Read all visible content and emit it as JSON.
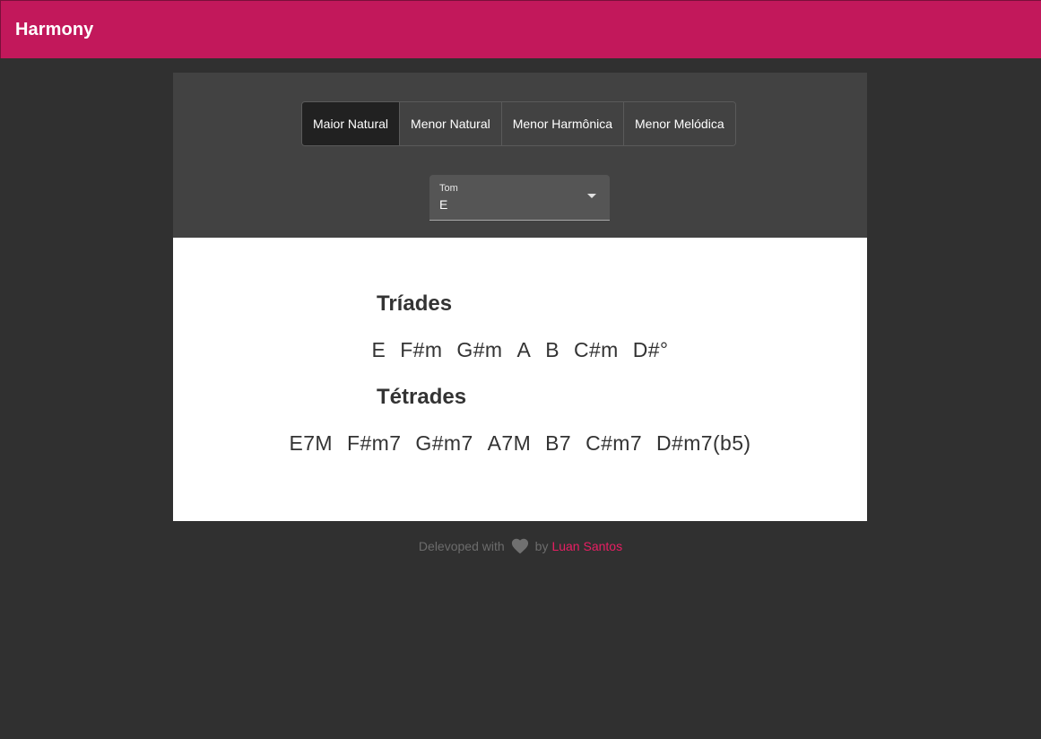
{
  "app": {
    "title": "Harmony"
  },
  "scales": {
    "items": [
      {
        "label": "Maior Natural",
        "selected": true
      },
      {
        "label": "Menor Natural",
        "selected": false
      },
      {
        "label": "Menor Harmônica",
        "selected": false
      },
      {
        "label": "Menor Melódica",
        "selected": false
      }
    ]
  },
  "key_select": {
    "label": "Tom",
    "value": "E"
  },
  "triads": {
    "title": "Tríades",
    "chords": [
      "E",
      "F#m",
      "G#m",
      "A",
      "B",
      "C#m",
      "D#°"
    ]
  },
  "tetrads": {
    "title": "Tétrades",
    "chords": [
      "E7M",
      "F#m7",
      "G#m7",
      "A7M",
      "B7",
      "C#m7",
      "D#m7(b5)"
    ]
  },
  "footer": {
    "prefix": "Delevoped with",
    "by": "by",
    "author": "Luan Santos",
    "heart_icon": "heart-icon",
    "author_color": "#e91e63"
  },
  "colors": {
    "primary": "#c2185b",
    "background": "#303030",
    "card_header": "#424242"
  }
}
